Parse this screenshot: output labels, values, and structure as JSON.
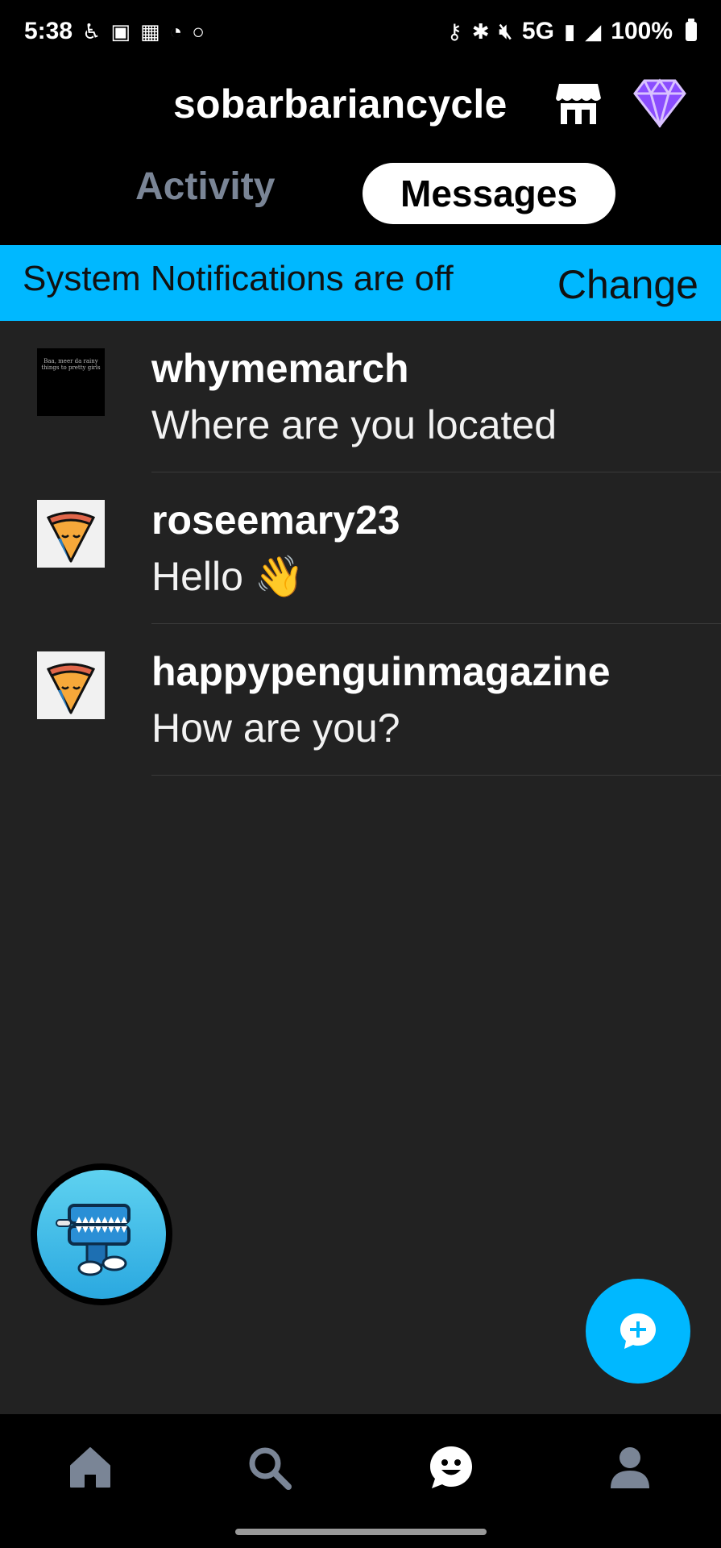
{
  "status_bar": {
    "time": "5:38",
    "network": "5G",
    "battery": "100%",
    "left_icons": [
      "accessibility-icon",
      "image-icon",
      "photos-icon",
      "wifi-calling-icon",
      "circle-icon"
    ],
    "right_icons": [
      "key-icon",
      "bluetooth-icon",
      "mute-icon",
      "signal-icon",
      "no-signal-icon"
    ]
  },
  "header": {
    "title": "sobarbariancycle",
    "shop_icon": "shop-icon",
    "premium_icon": "gem-icon"
  },
  "tabs": {
    "activity": "Activity",
    "messages": "Messages",
    "active": "Messages"
  },
  "notification_banner": {
    "text": "System Notifications are off",
    "action": "Change",
    "color": "#00b8ff"
  },
  "conversations": [
    {
      "name": "whymemarch",
      "message": "Where are you located",
      "avatar": "text-avatar",
      "avatar_text": "Baa, meer da rainy things to pretty girls"
    },
    {
      "name": "roseemary23",
      "message": "Hello 👋",
      "avatar": "pizza-avatar"
    },
    {
      "name": "happypenguinmagazine",
      "message": "How are you?",
      "avatar": "pizza-avatar"
    }
  ],
  "floating": {
    "sticker": "teeth-sticker-avatar",
    "compose": "compose-message-icon"
  },
  "bottom_nav": {
    "items": [
      "home-icon",
      "search-icon",
      "messages-icon",
      "account-icon"
    ],
    "active": "messages-icon"
  },
  "colors": {
    "background": "#222222",
    "accent": "#00b8ff",
    "header": "#000000",
    "inactive_tab": "#7a8596"
  }
}
